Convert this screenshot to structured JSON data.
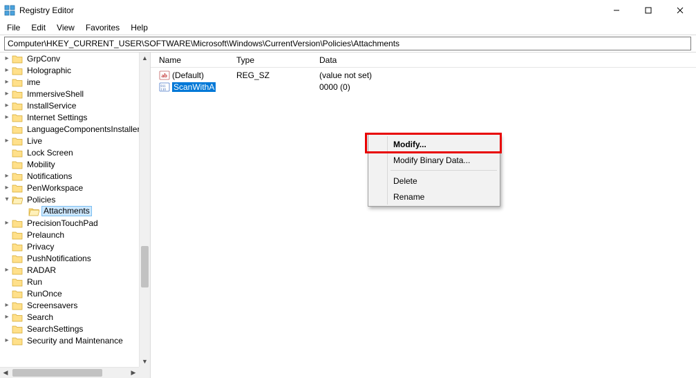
{
  "window": {
    "title": "Registry Editor"
  },
  "menu": {
    "file": "File",
    "edit": "Edit",
    "view": "View",
    "favorites": "Favorites",
    "help": "Help"
  },
  "address": {
    "path": "Computer\\HKEY_CURRENT_USER\\SOFTWARE\\Microsoft\\Windows\\CurrentVersion\\Policies\\Attachments"
  },
  "tree": {
    "items": [
      {
        "label": "GrpConv",
        "indent": 1,
        "exp": ">"
      },
      {
        "label": "Holographic",
        "indent": 1,
        "exp": ">"
      },
      {
        "label": "ime",
        "indent": 1,
        "exp": ">"
      },
      {
        "label": "ImmersiveShell",
        "indent": 1,
        "exp": ">"
      },
      {
        "label": "InstallService",
        "indent": 1,
        "exp": ">"
      },
      {
        "label": "Internet Settings",
        "indent": 1,
        "exp": ">"
      },
      {
        "label": "LanguageComponentsInstaller",
        "indent": 1,
        "exp": ""
      },
      {
        "label": "Live",
        "indent": 1,
        "exp": ">"
      },
      {
        "label": "Lock Screen",
        "indent": 1,
        "exp": ""
      },
      {
        "label": "Mobility",
        "indent": 1,
        "exp": ""
      },
      {
        "label": "Notifications",
        "indent": 1,
        "exp": ">"
      },
      {
        "label": "PenWorkspace",
        "indent": 1,
        "exp": ">"
      },
      {
        "label": "Policies",
        "indent": 1,
        "exp": "v",
        "expanded": true
      },
      {
        "label": "Attachments",
        "indent": 2,
        "exp": "",
        "selected": true
      },
      {
        "label": "PrecisionTouchPad",
        "indent": 1,
        "exp": ">"
      },
      {
        "label": "Prelaunch",
        "indent": 1,
        "exp": ""
      },
      {
        "label": "Privacy",
        "indent": 1,
        "exp": ""
      },
      {
        "label": "PushNotifications",
        "indent": 1,
        "exp": ""
      },
      {
        "label": "RADAR",
        "indent": 1,
        "exp": ">"
      },
      {
        "label": "Run",
        "indent": 1,
        "exp": ""
      },
      {
        "label": "RunOnce",
        "indent": 1,
        "exp": ""
      },
      {
        "label": "Screensavers",
        "indent": 1,
        "exp": ">"
      },
      {
        "label": "Search",
        "indent": 1,
        "exp": ">"
      },
      {
        "label": "SearchSettings",
        "indent": 1,
        "exp": ""
      },
      {
        "label": "Security and Maintenance",
        "indent": 1,
        "exp": ">"
      }
    ]
  },
  "list": {
    "headers": {
      "name": "Name",
      "type": "Type",
      "data": "Data"
    },
    "rows": [
      {
        "icon": "str",
        "name": "(Default)",
        "type": "REG_SZ",
        "data": "(value not set)",
        "selected": false
      },
      {
        "icon": "bin",
        "name": "ScanWithA",
        "type": "",
        "data": "0000 (0)",
        "selected": true
      }
    ]
  },
  "context_menu": {
    "modify": "Modify...",
    "modify_binary": "Modify Binary Data...",
    "delete": "Delete",
    "rename": "Rename"
  }
}
